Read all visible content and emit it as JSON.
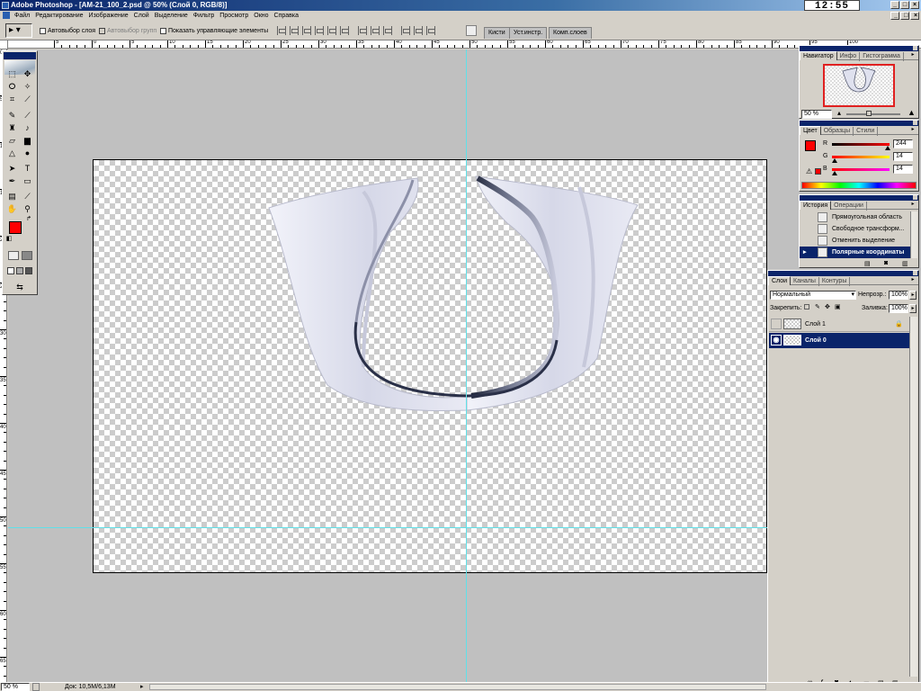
{
  "window": {
    "title": "Adobe Photoshop - [AM-21_100_2.psd @ 50% (Слой 0, RGB/8)]",
    "clock": "12:55",
    "min_btn": "_",
    "max_btn": "□",
    "close_btn": "×"
  },
  "menu": [
    "Файл",
    "Редактирование",
    "Изображение",
    "Слой",
    "Выделение",
    "Фильтр",
    "Просмотр",
    "Окно",
    "Справка"
  ],
  "options": {
    "tool_arrow": "▸",
    "auto_select_layer": "Автовыбор слоя",
    "auto_select_group": "Автовыбор групп",
    "show_transform": "Показать управляющие элементы",
    "well_tabs": [
      "Кисти",
      "Уст.инстр.",
      "Комп.слоев"
    ]
  },
  "ruler": {
    "h_labels": [
      "5",
      "0",
      "5",
      "10",
      "15",
      "20",
      "25",
      "30",
      "35",
      "40",
      "45",
      "50",
      "55",
      "60",
      "65",
      "70",
      "75",
      "80",
      "85",
      "90",
      "95",
      "100"
    ],
    "v_labels": [
      "0",
      "5",
      "10",
      "15",
      "20",
      "25",
      "30",
      "35",
      "40",
      "45",
      "50",
      "55",
      "60",
      "65"
    ]
  },
  "colors": {
    "foreground": "#ff0000",
    "background": "#ffffff",
    "accent": "#0a246a",
    "guide": "#60e0e8"
  },
  "navigator": {
    "tabs": [
      "Навигатор",
      "Инфо",
      "Гистограмма"
    ],
    "zoom": "50 %"
  },
  "color_panel": {
    "tabs": [
      "Цвет",
      "Образцы",
      "Стили"
    ],
    "r_label": "R",
    "r_value": "244",
    "g_label": "G",
    "g_value": "14",
    "b_label": "B",
    "b_value": "14"
  },
  "history": {
    "tabs": [
      "История",
      "Операции"
    ],
    "items": [
      "Прямоугольная область",
      "Свободное трансформ...",
      "Отменить выделение",
      "Полярные координаты"
    ]
  },
  "layers": {
    "tabs": [
      "Слои",
      "Каналы",
      "Контуры"
    ],
    "blend_mode": "Нормальный",
    "opacity_label": "Непрозр.:",
    "opacity": "100%",
    "lock_label": "Закрепить:",
    "fill_label": "Заливка:",
    "fill": "100%",
    "items": [
      {
        "name": "Слой 1",
        "visible": false,
        "selected": false,
        "locked": true
      },
      {
        "name": "Слой 0",
        "visible": true,
        "selected": true,
        "locked": false
      }
    ]
  },
  "status": {
    "zoom": "50 %",
    "doc": "Док: 10,5М/6,13М"
  }
}
